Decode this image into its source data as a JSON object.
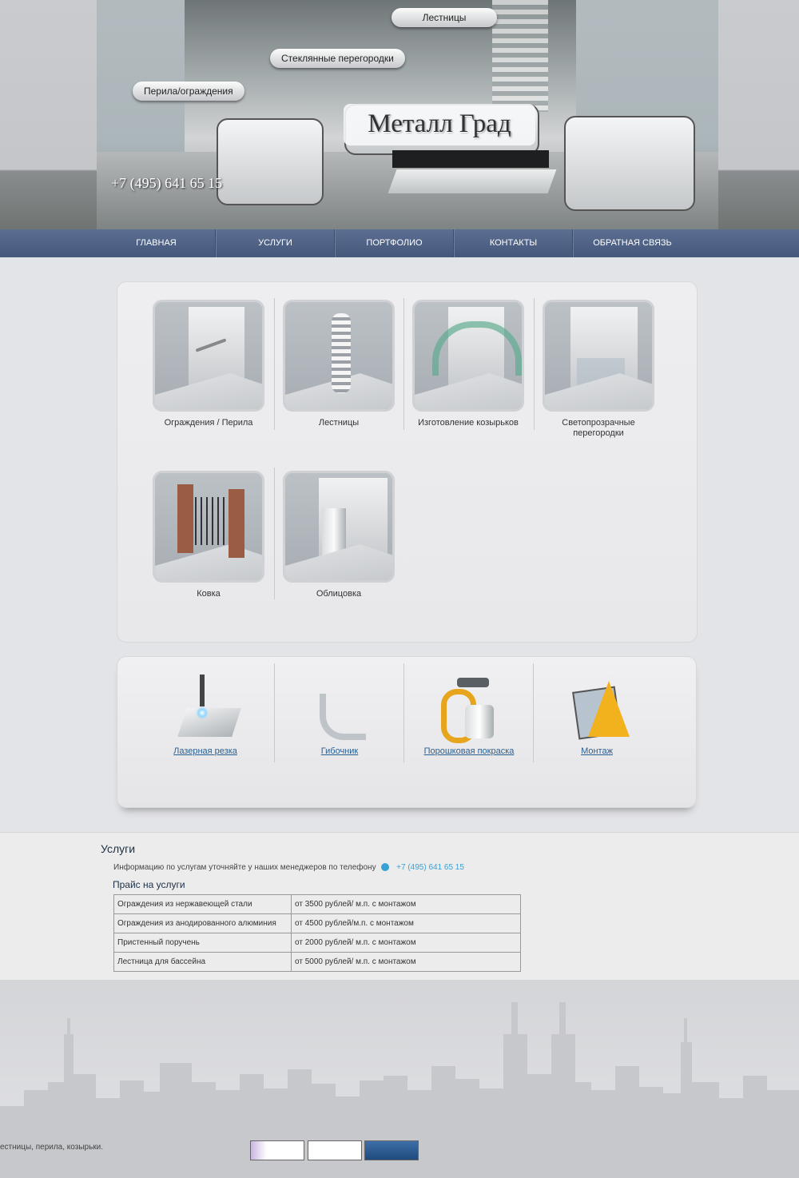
{
  "header": {
    "bubbles": [
      "Лестницы",
      "Стеклянные перегородки",
      "Перила/ограждения"
    ],
    "logo": "Металл Град",
    "phone": "+7 (495) 641 65 15"
  },
  "nav": [
    "ГЛАВНАЯ",
    "УСЛУГИ",
    "ПОРТФОЛИО",
    "КОНТАКТЫ",
    "ОБРАТНАЯ СВЯЗЬ"
  ],
  "cards": [
    "Ограждения / Перила",
    "Лестницы",
    "Изготовление козырьков",
    "Светопрозрачные перегородки",
    "Ковка",
    "Облицовка"
  ],
  "services": [
    "Лазерная резка",
    "Гибочник",
    "Порошковая покраска",
    "Монтаж"
  ],
  "content": {
    "title": "Услуги",
    "info": "Информацию по услугам уточняйте у наших менеджеров по телефону",
    "phone": "+7 (495) 641 65 15",
    "price_title": "Прайс на услуги",
    "price": [
      [
        "Ограждения из нержавеющей стали",
        "от 3500 рублей/ м.п.  с монтажом"
      ],
      [
        "Ограждения из анодированного алюминия",
        "от 4500 рублей/м.п. с монтажом"
      ],
      [
        "Пристенный поручень",
        "от 2000 рублей/ м.п. с монтажом"
      ],
      [
        "Лестница для бассейна",
        "от 5000 рублей/ м.п. с монтажом"
      ]
    ]
  },
  "footer": {
    "description": "естницы, перила, козырьки."
  },
  "colors": {
    "nav_bg": "#4c5f83",
    "link": "#2b5f8f",
    "phone_link": "#3aa1d7"
  }
}
